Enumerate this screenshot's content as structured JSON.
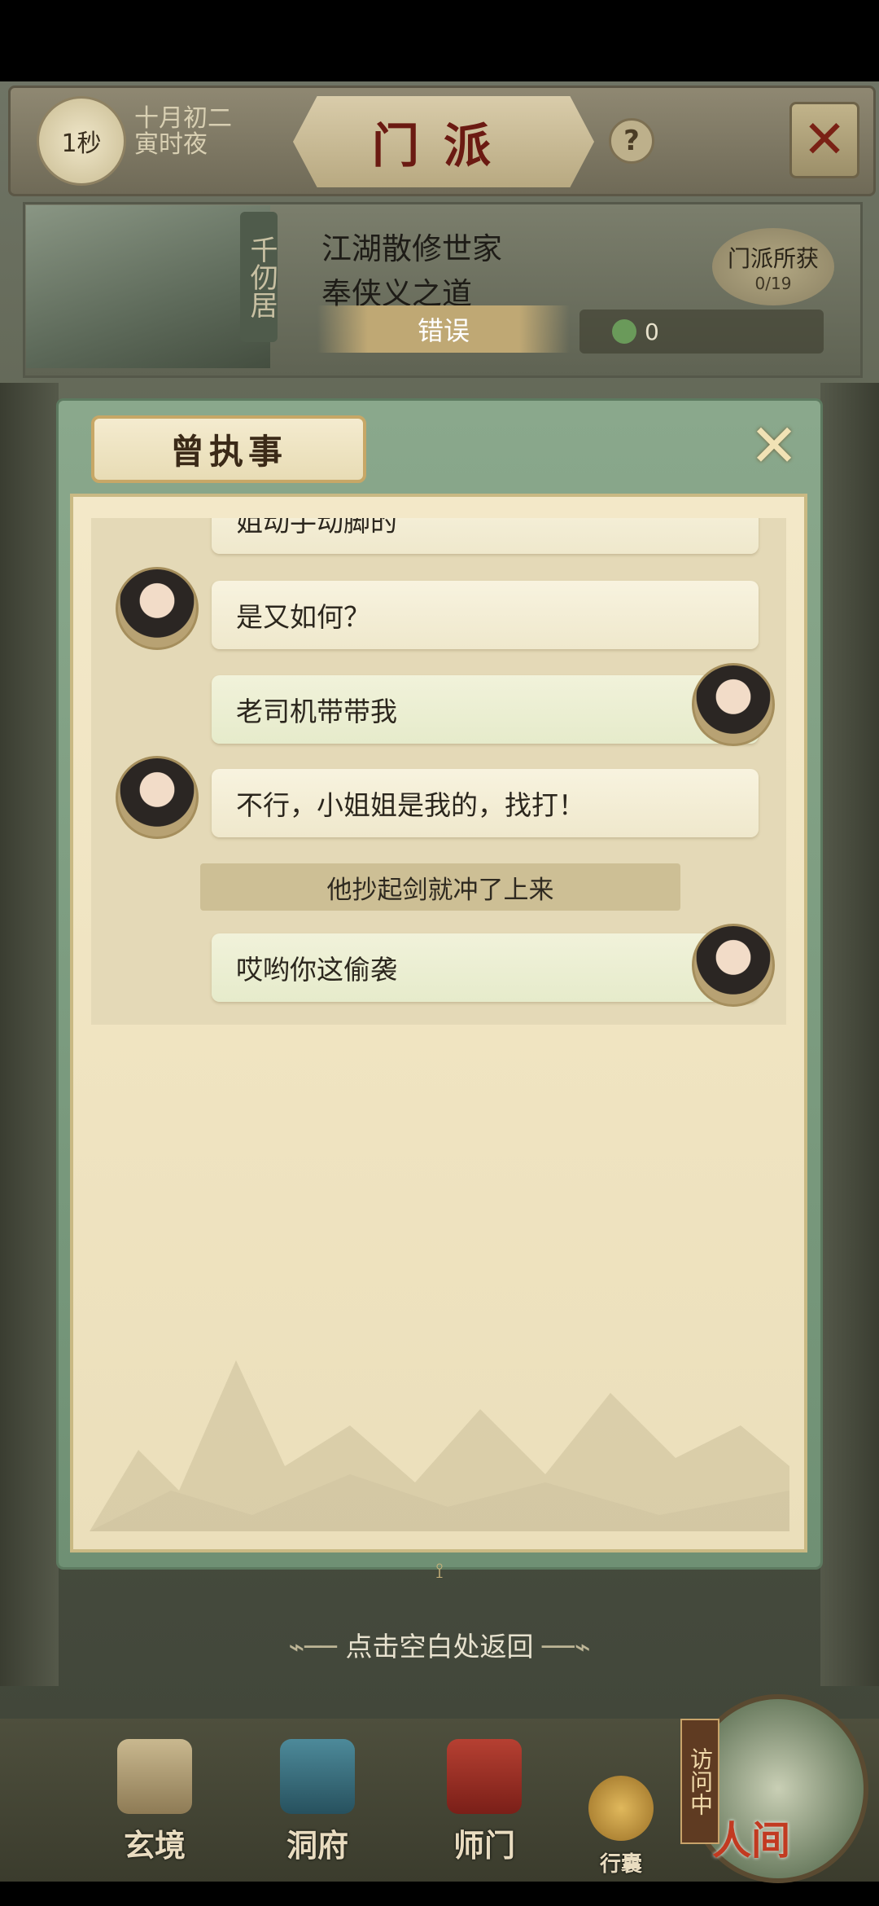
{
  "top_bar": {
    "timer": "1秒",
    "date_line1": "十月初二",
    "date_line2": "寅时夜",
    "title": "门派",
    "help_label": "?"
  },
  "banner": {
    "vertical_name": "千仞居",
    "line1": "江湖散修世家",
    "line2": "奉侠义之道",
    "harvest_label": "门派所获",
    "harvest_count": "0/19",
    "error_label": "错误",
    "coin_count": "0"
  },
  "modal": {
    "title": "曾执事",
    "messages": [
      {
        "speaker": "female",
        "text": "姐动手动脚的"
      },
      {
        "speaker": "female",
        "text": "是又如何？"
      },
      {
        "speaker": "male",
        "text": "老司机带带我"
      },
      {
        "speaker": "female",
        "text": "不行，小姐姐是我的，找打！"
      },
      {
        "speaker": "narration",
        "text": "他抄起剑就冲了上来"
      },
      {
        "speaker": "male",
        "text": "哎哟你这偷袭"
      }
    ]
  },
  "back_hint": "点击空白处返回",
  "bottom_nav": {
    "items": [
      {
        "label": "玄境"
      },
      {
        "label": "洞府"
      },
      {
        "label": "师门"
      },
      {
        "label": "行囊"
      }
    ],
    "visiting": "访问中",
    "world": "人间"
  },
  "colors": {
    "title_red": "#6b1a12",
    "modal_frame_green": "#7a9a7e",
    "paper": "#f1e6c4",
    "narration_bg": "#cdbf95"
  }
}
